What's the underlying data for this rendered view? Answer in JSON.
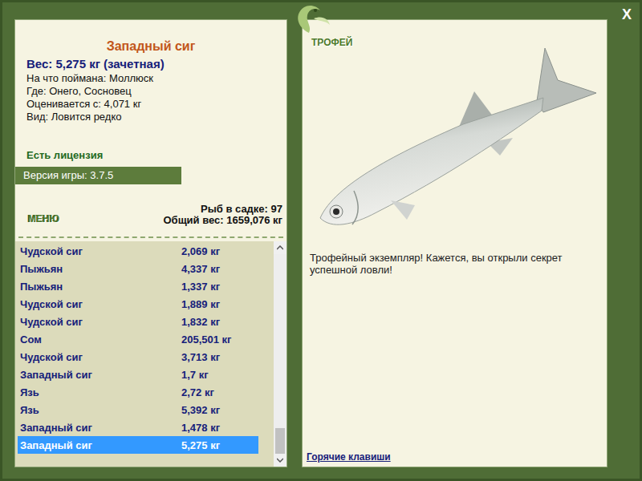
{
  "window": {
    "close": "X"
  },
  "fish": {
    "title": "Западный сиг",
    "weight": "Вес: 5,275 кг (зачетная)",
    "details": [
      "На что поймана: Моллюск",
      "Где: Онего, Сосновец",
      "Оценивается с: 4,071 кг",
      "Вид: Ловится редко"
    ]
  },
  "license": "Есть лицензия",
  "version": "Версия игры: 3.7.5",
  "menu": "МЕНЮ",
  "stats": [
    "Рыб в садке: 97",
    "Общий вес: 1659,076 кг"
  ],
  "catch_list": {
    "rows": [
      {
        "name": "Чудской сиг",
        "weight": "2,069 кг",
        "selected": false
      },
      {
        "name": "Пыжьян",
        "weight": "4,337 кг",
        "selected": false
      },
      {
        "name": "Пыжьян",
        "weight": "1,337 кг",
        "selected": false
      },
      {
        "name": "Чудской сиг",
        "weight": "1,889 кг",
        "selected": false
      },
      {
        "name": "Чудской сиг",
        "weight": "1,832 кг",
        "selected": false
      },
      {
        "name": "Сом",
        "weight": "205,501 кг",
        "selected": false
      },
      {
        "name": "Чудской сиг",
        "weight": "3,713 кг",
        "selected": false
      },
      {
        "name": "Западный сиг",
        "weight": "1,7 кг",
        "selected": false
      },
      {
        "name": "Язь",
        "weight": "2,72 кг",
        "selected": false
      },
      {
        "name": "Язь",
        "weight": "5,392 кг",
        "selected": false
      },
      {
        "name": "Западный сиг",
        "weight": "1,478 кг",
        "selected": false
      },
      {
        "name": "Западный сиг",
        "weight": "5,275 кг",
        "selected": true
      }
    ],
    "scrollbar": {
      "level": 1
    }
  },
  "trophy": {
    "label": "ТРОФЕЙ",
    "message": "Трофейный экземпляр! Кажется, вы открыли секрет успешной ловли!",
    "hotkeys": "Горячие клавиши"
  }
}
